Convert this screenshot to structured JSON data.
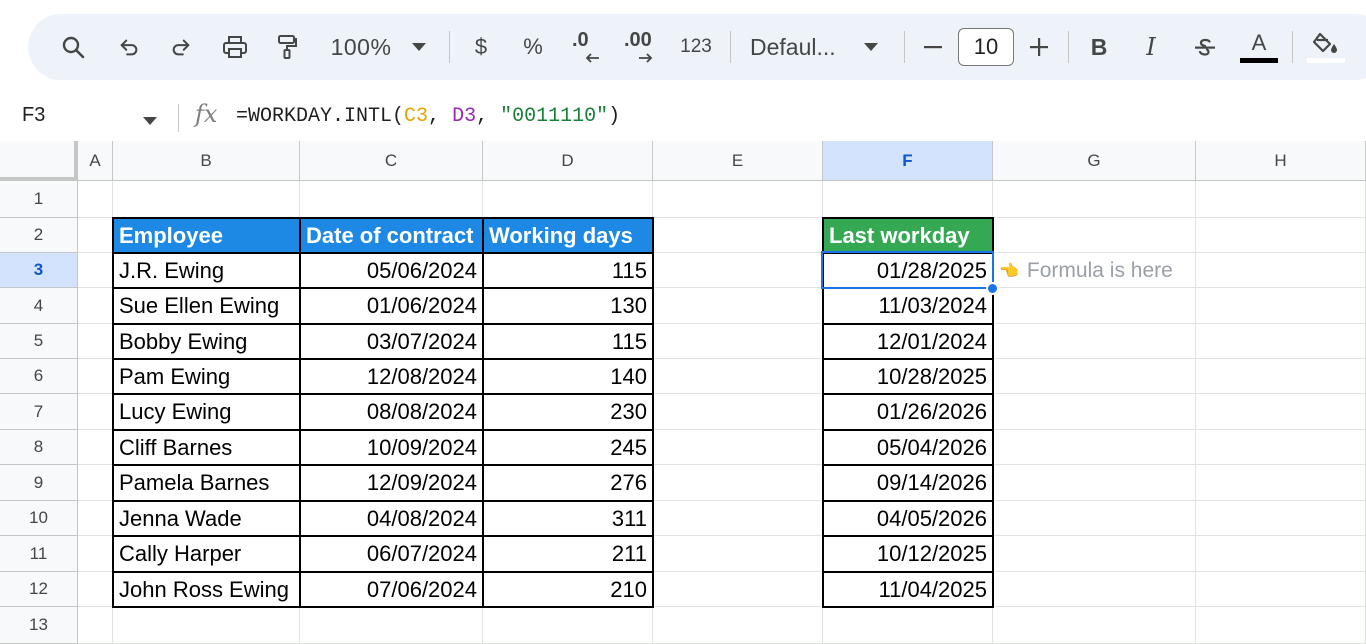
{
  "toolbar": {
    "zoom": "100%",
    "currency": "$",
    "percent": "%",
    "decrease_decimal": ".0",
    "increase_decimal": ".00",
    "number_format": "123",
    "font": "Defaul...",
    "font_size": "10",
    "bold": "B",
    "italic": "I",
    "text_color_label": "A",
    "colors": {
      "text_color_bar": "#000000",
      "fill_color_bar": "#ffffff"
    }
  },
  "formula_bar": {
    "cell_ref": "F3",
    "formula_prefix": "=WORKDAY.INTL(",
    "arg1": "C3",
    "sep1": ", ",
    "arg2": "D3",
    "sep2": ", ",
    "arg3": "\"0011110\"",
    "formula_suffix": ")"
  },
  "columns": [
    "A",
    "B",
    "C",
    "D",
    "E",
    "F",
    "G",
    "H"
  ],
  "rows": [
    "1",
    "2",
    "3",
    "4",
    "5",
    "6",
    "7",
    "8",
    "9",
    "10",
    "11",
    "12",
    "13"
  ],
  "selected": {
    "column": "F",
    "row": "3"
  },
  "table": {
    "headers": [
      "Employee",
      "Date of contract",
      "Working days"
    ],
    "rows": [
      [
        "J.R. Ewing",
        "05/06/2024",
        "115"
      ],
      [
        "Sue Ellen Ewing",
        "01/06/2024",
        "130"
      ],
      [
        "Bobby Ewing",
        "03/07/2024",
        "115"
      ],
      [
        "Pam Ewing",
        "12/08/2024",
        "140"
      ],
      [
        "Lucy Ewing",
        "08/08/2024",
        "230"
      ],
      [
        "Cliff Barnes",
        "10/09/2024",
        "245"
      ],
      [
        "Pamela Barnes",
        "12/09/2024",
        "276"
      ],
      [
        "Jenna Wade",
        "04/08/2024",
        "311"
      ],
      [
        "Cally Harper",
        "06/07/2024",
        "211"
      ],
      [
        "John Ross Ewing",
        "07/06/2024",
        "210"
      ]
    ],
    "header_color": "#1e88e5"
  },
  "result": {
    "header": "Last workday",
    "values": [
      "01/28/2025",
      "11/03/2024",
      "12/01/2024",
      "10/28/2025",
      "01/26/2026",
      "05/04/2026",
      "09/14/2026",
      "04/05/2026",
      "10/12/2025",
      "11/04/2025"
    ],
    "header_color": "#34a853"
  },
  "annotation": {
    "icon": "pointing-hand-icon",
    "glyph": "👈",
    "text": "Formula is here"
  }
}
